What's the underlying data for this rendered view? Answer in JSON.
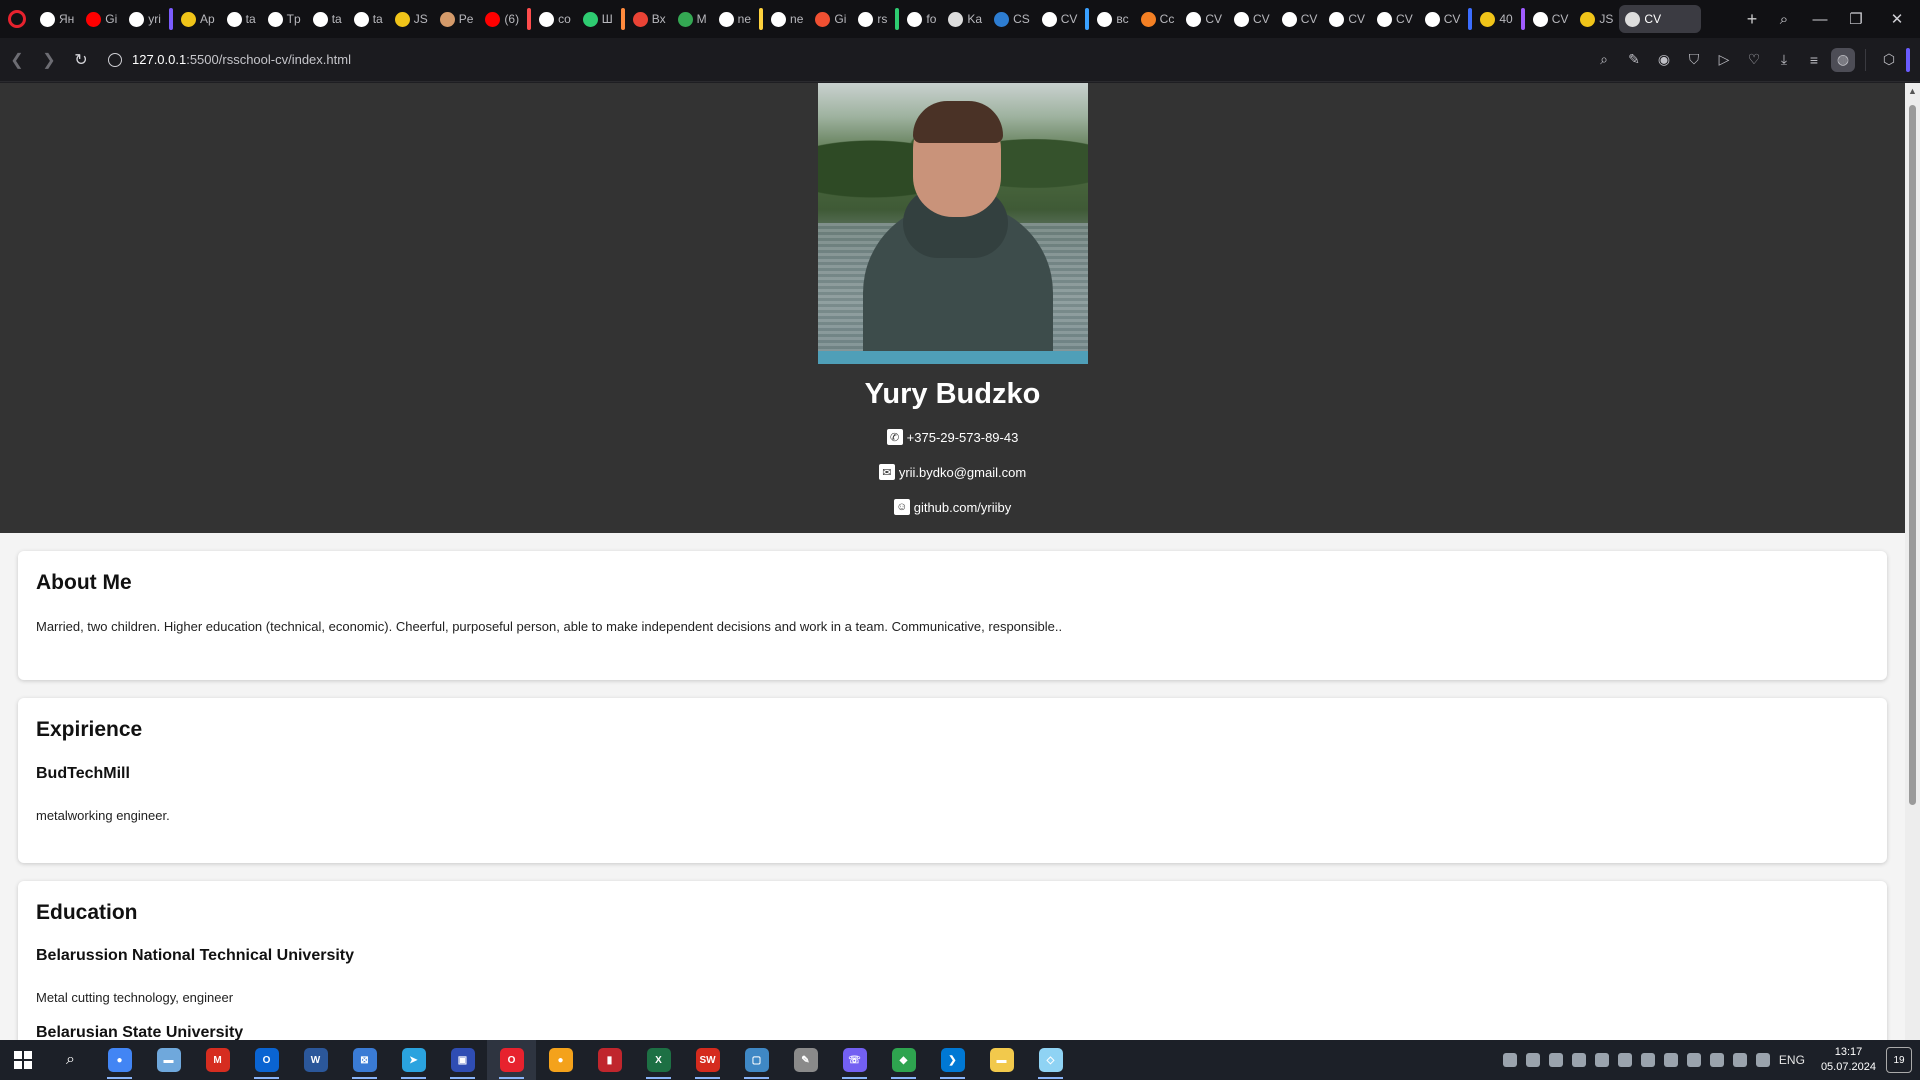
{
  "browser": {
    "tabs": [
      {
        "label": "Ян",
        "icon": "yandex-icon",
        "color": "#ffffff"
      },
      {
        "label": "Gi",
        "icon": "youtube-icon",
        "color": "#ff0000"
      },
      {
        "label": "yri",
        "icon": "github-icon",
        "color": "#ffffff"
      },
      {
        "label": "Ap",
        "icon": "rs-icon",
        "color": "#f0c419"
      },
      {
        "label": "ta",
        "icon": "github-icon",
        "color": "#ffffff"
      },
      {
        "label": "Tp",
        "icon": "rs-icon",
        "color": "#ffffff"
      },
      {
        "label": "ta",
        "icon": "github-icon",
        "color": "#ffffff"
      },
      {
        "label": "ta",
        "icon": "github-icon",
        "color": "#ffffff"
      },
      {
        "label": "JS",
        "icon": "rs-icon",
        "color": "#f0c419"
      },
      {
        "label": "Pe",
        "icon": "person-icon",
        "color": "#d49a6a"
      },
      {
        "label": "(6)",
        "icon": "youtube-icon",
        "color": "#ff0000"
      },
      {
        "label": "co",
        "icon": "google-icon",
        "color": "#ffffff"
      },
      {
        "label": "Ш",
        "icon": "play-icon",
        "color": "#2ecc71"
      },
      {
        "label": "Вх",
        "icon": "gmail-icon",
        "color": "#ea4335"
      },
      {
        "label": "M",
        "icon": "drive-icon",
        "color": "#34a853"
      },
      {
        "label": "ne",
        "icon": "google-icon",
        "color": "#ffffff"
      },
      {
        "label": "ne",
        "icon": "google-icon",
        "color": "#ffffff"
      },
      {
        "label": "Gi",
        "icon": "git-icon",
        "color": "#f05032"
      },
      {
        "label": "rs",
        "icon": "google-icon",
        "color": "#ffffff"
      },
      {
        "label": "fo",
        "icon": "google-icon",
        "color": "#ffffff"
      },
      {
        "label": "Ka",
        "icon": "app-icon",
        "color": "#dddddd"
      },
      {
        "label": "CS",
        "icon": "css-icon",
        "color": "#2d7dd2"
      },
      {
        "label": "CV",
        "icon": "cv-icon",
        "color": "#ffffff"
      },
      {
        "label": "вс",
        "icon": "google-icon",
        "color": "#ffffff"
      },
      {
        "label": "Cc",
        "icon": "stack-icon",
        "color": "#f48024"
      },
      {
        "label": "CV",
        "icon": "cv-icon",
        "color": "#ffffff"
      },
      {
        "label": "CV",
        "icon": "cv-icon",
        "color": "#ffffff"
      },
      {
        "label": "CV",
        "icon": "cv-icon",
        "color": "#ffffff"
      },
      {
        "label": "CV",
        "icon": "cv-icon",
        "color": "#ffffff"
      },
      {
        "label": "CV",
        "icon": "cv-icon",
        "color": "#ffffff"
      },
      {
        "label": "CV",
        "icon": "cv-icon",
        "color": "#ffffff"
      },
      {
        "label": "40",
        "icon": "rs-icon",
        "color": "#f0c419"
      },
      {
        "label": "CV",
        "icon": "cv-icon",
        "color": "#ffffff"
      },
      {
        "label": "JS",
        "icon": "rs-icon",
        "color": "#f0c419"
      }
    ],
    "active_tab": {
      "label": "CV",
      "icon": "cv-icon"
    },
    "url_host": "127.0.0.1",
    "url_path": ":5500/rsschool-cv/index.html",
    "accent": "#e7222e"
  },
  "page": {
    "name": "Yury Budzko",
    "phone": "+375-29-573-89-43",
    "email": "yrii.bydko@gmail.com",
    "github": "github.com/yriiby",
    "about": {
      "title": "About Me",
      "text": "Married, two children. Higher education (technical, economic). Cheerful, purposeful person, able to make independent decisions and work in a team. Communicative, responsible.."
    },
    "experience": {
      "title": "Expirience",
      "company": "BudTechMill",
      "role": "metalworking engineer."
    },
    "education": {
      "title": "Education",
      "items": [
        {
          "school": "Belarussion National Technical University",
          "detail": "Metal cutting technology, engineer"
        },
        {
          "school": "Belarusian State University",
          "detail": ""
        }
      ]
    }
  },
  "taskbar": {
    "apps": [
      {
        "name": "chrome",
        "color": "#4285f4",
        "glyph": "●"
      },
      {
        "name": "tablet-app",
        "color": "#6fa8dc",
        "glyph": "▬"
      },
      {
        "name": "m-app",
        "color": "#d62d20",
        "glyph": "M"
      },
      {
        "name": "outlook",
        "color": "#0a64d2",
        "glyph": "O"
      },
      {
        "name": "word",
        "color": "#2b579a",
        "glyph": "W"
      },
      {
        "name": "remote-app",
        "color": "#3a7bd5",
        "glyph": "⊠"
      },
      {
        "name": "telegram",
        "color": "#2aa3df",
        "glyph": "➤"
      },
      {
        "name": "save-app",
        "color": "#2f4db3",
        "glyph": "▣"
      },
      {
        "name": "opera",
        "color": "#e7222e",
        "glyph": "O"
      },
      {
        "name": "chromium-app",
        "color": "#f4a21b",
        "glyph": "●"
      },
      {
        "name": "reader-app",
        "color": "#c0262d",
        "glyph": "▮"
      },
      {
        "name": "excel",
        "color": "#1d7044",
        "glyph": "X"
      },
      {
        "name": "solidworks",
        "color": "#d52b1e",
        "glyph": "SW"
      },
      {
        "name": "window-app",
        "color": "#3f88c5",
        "glyph": "▢"
      },
      {
        "name": "notepad-app",
        "color": "#8a8a8a",
        "glyph": "✎"
      },
      {
        "name": "viber",
        "color": "#7360f2",
        "glyph": "☏"
      },
      {
        "name": "git-app",
        "color": "#2ea44f",
        "glyph": "◆"
      },
      {
        "name": "vscode",
        "color": "#0078d4",
        "glyph": "❯"
      },
      {
        "name": "files",
        "color": "#f2c94c",
        "glyph": "▬"
      },
      {
        "name": "notes-app",
        "color": "#8fd3f4",
        "glyph": "◇"
      }
    ],
    "lang": "ENG",
    "time": "13:17",
    "date": "05.07.2024",
    "notifications": "19"
  }
}
